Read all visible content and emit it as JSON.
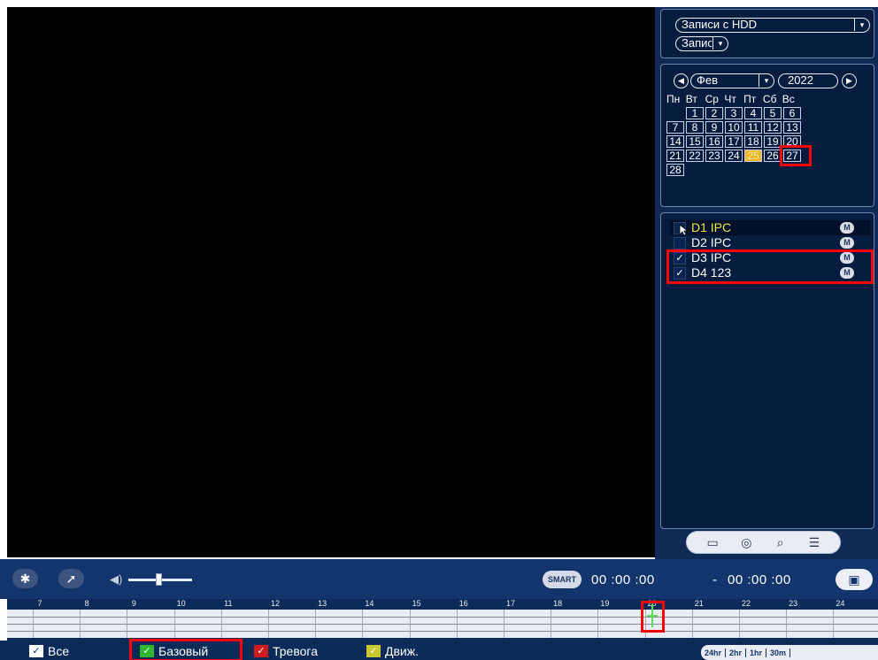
{
  "source_panel": {
    "source_select": "Записи с HDD",
    "type_select": "Запис"
  },
  "calendar": {
    "month": "Фев",
    "year": "2022",
    "weekdays": [
      "Пн",
      "Вт",
      "Ср",
      "Чт",
      "Пт",
      "Сб",
      "Вс"
    ],
    "days": [
      "1",
      "2",
      "3",
      "4",
      "5",
      "6",
      "7",
      "8",
      "9",
      "10",
      "11",
      "12",
      "13",
      "14",
      "15",
      "16",
      "17",
      "18",
      "19",
      "20",
      "21",
      "22",
      "23",
      "24",
      "25",
      "26",
      "27",
      "28"
    ],
    "selected_day": "25"
  },
  "channels": [
    {
      "label": "D1 IPC",
      "checked": false,
      "badge": "M"
    },
    {
      "label": "D2 IPC",
      "checked": false,
      "badge": "M"
    },
    {
      "label": "D3 IPC",
      "checked": true,
      "badge": "M"
    },
    {
      "label": "D4 123",
      "checked": true,
      "badge": "M"
    }
  ],
  "playback": {
    "smart_label": "SMART",
    "start_time": "00 :00 :00",
    "separator": "-",
    "end_time": "00 :00 :00"
  },
  "timeline": {
    "hours": [
      "7",
      "8",
      "9",
      "10",
      "11",
      "12",
      "13",
      "14",
      "15",
      "16",
      "17",
      "18",
      "19",
      "20",
      "21",
      "22",
      "23",
      "24"
    ],
    "cursor_hour": 19.5
  },
  "legend": {
    "all": "Все",
    "regular": "Базовый",
    "alarm": "Тревога",
    "motion": "Движ.",
    "zoom": [
      "24hr",
      "2hr",
      "1hr",
      "30m"
    ]
  },
  "colors": {
    "regular": "#2fb72f",
    "alarm": "#d21b1b",
    "motion": "#c8c832",
    "selected_day": "#f3b328",
    "highlight": "#ff0000",
    "panel": "#0e2a55"
  }
}
